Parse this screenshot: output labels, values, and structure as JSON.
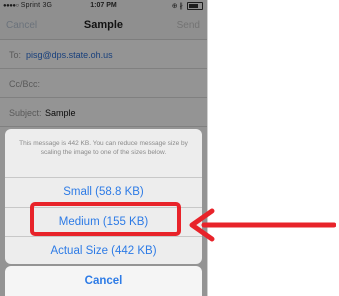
{
  "status_bar": {
    "signal_dots": "●●●●○",
    "carrier": "Sprint",
    "network": "3G",
    "time": "1:07 PM",
    "right_icons": "⊕ ∦",
    "battery_level": 0.75
  },
  "nav": {
    "cancel_label": "Cancel",
    "title": "Sample",
    "send_label": "Send"
  },
  "compose": {
    "to_label": "To:",
    "to_value": "pisg@dps.state.oh.us",
    "cc_label": "Cc/Bcc:",
    "subject_label": "Subject:",
    "subject_value": "Sample"
  },
  "sheet": {
    "message": "This message is 442 KB. You can reduce message size by scaling the image to one of the sizes below.",
    "options": [
      {
        "label": "Small (58.8 KB)"
      },
      {
        "label": "Medium (155 KB)"
      },
      {
        "label": "Actual Size (442 KB)"
      }
    ],
    "cancel_label": "Cancel"
  },
  "annotation": {
    "color": "#e8232a",
    "highlighted_option": "Medium (155 KB)"
  }
}
